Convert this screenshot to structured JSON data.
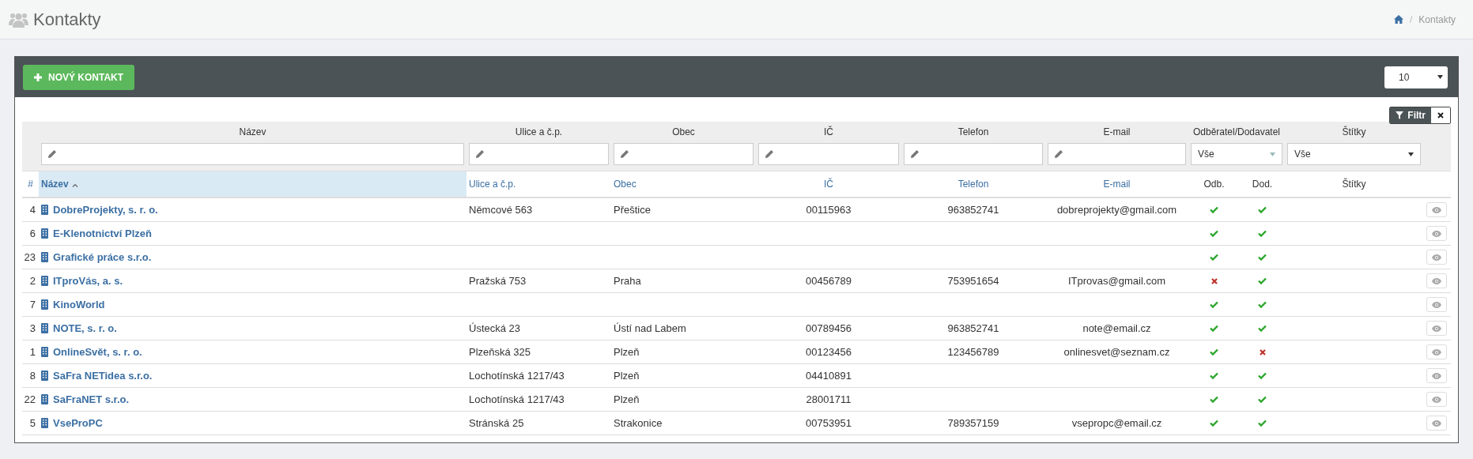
{
  "page": {
    "title": "Kontakty"
  },
  "breadcrumb": {
    "separator": "/",
    "current": "Kontakty"
  },
  "toolbar": {
    "new_button": "NOVÝ KONTAKT",
    "page_size": "10"
  },
  "filter": {
    "button": "Filtr",
    "fields": [
      {
        "kind": "text",
        "label": "Název"
      },
      {
        "kind": "text",
        "label": "Ulice a č.p."
      },
      {
        "kind": "text",
        "label": "Obec"
      },
      {
        "kind": "text",
        "label": "IČ"
      },
      {
        "kind": "text",
        "label": "Telefon"
      },
      {
        "kind": "text",
        "label": "E-mail"
      },
      {
        "kind": "pair-select",
        "label": "Odběratel/Dodavatel",
        "value": "Vše",
        "disabled": true
      },
      {
        "kind": "select",
        "label": "Štítky",
        "value": "Vše",
        "disabled": false
      }
    ]
  },
  "table": {
    "columns": [
      {
        "label": "#",
        "sorted": false
      },
      {
        "label": "Název",
        "sorted": true
      },
      {
        "label": "Ulice a č.p.",
        "sorted": false
      },
      {
        "label": "Obec",
        "sorted": false
      },
      {
        "label": "IČ",
        "sorted": false
      },
      {
        "label": "Telefon",
        "sorted": false
      },
      {
        "label": "E-mail",
        "sorted": false
      },
      {
        "label": "Odb.",
        "sorted": false
      },
      {
        "label": "Dod.",
        "sorted": false
      },
      {
        "label": "Štítky",
        "sorted": false
      }
    ],
    "rows": [
      {
        "id": "4",
        "name": "DobreProjekty, s. r. o.",
        "street": "Němcové 563",
        "city": "Přeštice",
        "ic": "00115963",
        "phone": "963852741",
        "email": "dobreprojekty@gmail.com",
        "customer": true,
        "supplier": true
      },
      {
        "id": "6",
        "name": "E-Klenotnictví Plzeň",
        "customer": true,
        "supplier": true
      },
      {
        "id": "23",
        "name": "Grafické práce s.r.o.",
        "customer": true,
        "supplier": true
      },
      {
        "id": "2",
        "name": "ITproVás, a. s.",
        "street": "Pražská 753",
        "city": "Praha",
        "ic": "00456789",
        "phone": "753951654",
        "email": "ITprovas@gmail.com",
        "customer": false,
        "supplier": true
      },
      {
        "id": "7",
        "name": "KinoWorld",
        "customer": true,
        "supplier": true
      },
      {
        "id": "3",
        "name": "NOTE, s. r. o.",
        "street": "Ústecká 23",
        "city": "Ústí nad Labem",
        "ic": "00789456",
        "phone": "963852741",
        "email": "note@email.cz",
        "customer": true,
        "supplier": true
      },
      {
        "id": "1",
        "name": "OnlineSvět, s. r. o.",
        "street": "Plzeňská 325",
        "city": "Plzeň",
        "ic": "00123456",
        "phone": "123456789",
        "email": "onlinesvet@seznam.cz",
        "customer": true,
        "supplier": false
      },
      {
        "id": "8",
        "name": "SaFra NETidea s.r.o.",
        "street": "Lochotínská 1217/43",
        "city": "Plzeň",
        "ic": "04410891",
        "customer": true,
        "supplier": true
      },
      {
        "id": "22",
        "name": "SaFraNET s.r.o.",
        "street": "Lochotínská 1217/43",
        "city": "Plzeň",
        "ic": "28001711",
        "customer": true,
        "supplier": true
      },
      {
        "id": "5",
        "name": "VseProPC",
        "street": "Stránská 25",
        "city": "Strakonice",
        "ic": "00753951",
        "phone": "789357159",
        "email": "vsepropc@email.cz",
        "customer": true,
        "supplier": true
      }
    ]
  }
}
